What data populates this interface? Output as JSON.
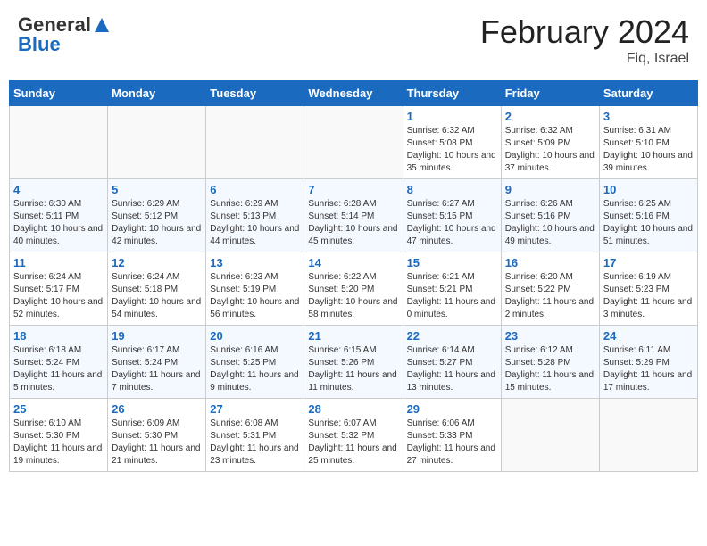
{
  "header": {
    "logo_general": "General",
    "logo_blue": "Blue",
    "month_title": "February 2024",
    "location": "Fiq, Israel"
  },
  "weekdays": [
    "Sunday",
    "Monday",
    "Tuesday",
    "Wednesday",
    "Thursday",
    "Friday",
    "Saturday"
  ],
  "weeks": [
    [
      {
        "day": null,
        "sunrise": null,
        "sunset": null,
        "daylight": null
      },
      {
        "day": null,
        "sunrise": null,
        "sunset": null,
        "daylight": null
      },
      {
        "day": null,
        "sunrise": null,
        "sunset": null,
        "daylight": null
      },
      {
        "day": null,
        "sunrise": null,
        "sunset": null,
        "daylight": null
      },
      {
        "day": "1",
        "sunrise": "Sunrise: 6:32 AM",
        "sunset": "Sunset: 5:08 PM",
        "daylight": "Daylight: 10 hours and 35 minutes."
      },
      {
        "day": "2",
        "sunrise": "Sunrise: 6:32 AM",
        "sunset": "Sunset: 5:09 PM",
        "daylight": "Daylight: 10 hours and 37 minutes."
      },
      {
        "day": "3",
        "sunrise": "Sunrise: 6:31 AM",
        "sunset": "Sunset: 5:10 PM",
        "daylight": "Daylight: 10 hours and 39 minutes."
      }
    ],
    [
      {
        "day": "4",
        "sunrise": "Sunrise: 6:30 AM",
        "sunset": "Sunset: 5:11 PM",
        "daylight": "Daylight: 10 hours and 40 minutes."
      },
      {
        "day": "5",
        "sunrise": "Sunrise: 6:29 AM",
        "sunset": "Sunset: 5:12 PM",
        "daylight": "Daylight: 10 hours and 42 minutes."
      },
      {
        "day": "6",
        "sunrise": "Sunrise: 6:29 AM",
        "sunset": "Sunset: 5:13 PM",
        "daylight": "Daylight: 10 hours and 44 minutes."
      },
      {
        "day": "7",
        "sunrise": "Sunrise: 6:28 AM",
        "sunset": "Sunset: 5:14 PM",
        "daylight": "Daylight: 10 hours and 45 minutes."
      },
      {
        "day": "8",
        "sunrise": "Sunrise: 6:27 AM",
        "sunset": "Sunset: 5:15 PM",
        "daylight": "Daylight: 10 hours and 47 minutes."
      },
      {
        "day": "9",
        "sunrise": "Sunrise: 6:26 AM",
        "sunset": "Sunset: 5:16 PM",
        "daylight": "Daylight: 10 hours and 49 minutes."
      },
      {
        "day": "10",
        "sunrise": "Sunrise: 6:25 AM",
        "sunset": "Sunset: 5:16 PM",
        "daylight": "Daylight: 10 hours and 51 minutes."
      }
    ],
    [
      {
        "day": "11",
        "sunrise": "Sunrise: 6:24 AM",
        "sunset": "Sunset: 5:17 PM",
        "daylight": "Daylight: 10 hours and 52 minutes."
      },
      {
        "day": "12",
        "sunrise": "Sunrise: 6:24 AM",
        "sunset": "Sunset: 5:18 PM",
        "daylight": "Daylight: 10 hours and 54 minutes."
      },
      {
        "day": "13",
        "sunrise": "Sunrise: 6:23 AM",
        "sunset": "Sunset: 5:19 PM",
        "daylight": "Daylight: 10 hours and 56 minutes."
      },
      {
        "day": "14",
        "sunrise": "Sunrise: 6:22 AM",
        "sunset": "Sunset: 5:20 PM",
        "daylight": "Daylight: 10 hours and 58 minutes."
      },
      {
        "day": "15",
        "sunrise": "Sunrise: 6:21 AM",
        "sunset": "Sunset: 5:21 PM",
        "daylight": "Daylight: 11 hours and 0 minutes."
      },
      {
        "day": "16",
        "sunrise": "Sunrise: 6:20 AM",
        "sunset": "Sunset: 5:22 PM",
        "daylight": "Daylight: 11 hours and 2 minutes."
      },
      {
        "day": "17",
        "sunrise": "Sunrise: 6:19 AM",
        "sunset": "Sunset: 5:23 PM",
        "daylight": "Daylight: 11 hours and 3 minutes."
      }
    ],
    [
      {
        "day": "18",
        "sunrise": "Sunrise: 6:18 AM",
        "sunset": "Sunset: 5:24 PM",
        "daylight": "Daylight: 11 hours and 5 minutes."
      },
      {
        "day": "19",
        "sunrise": "Sunrise: 6:17 AM",
        "sunset": "Sunset: 5:24 PM",
        "daylight": "Daylight: 11 hours and 7 minutes."
      },
      {
        "day": "20",
        "sunrise": "Sunrise: 6:16 AM",
        "sunset": "Sunset: 5:25 PM",
        "daylight": "Daylight: 11 hours and 9 minutes."
      },
      {
        "day": "21",
        "sunrise": "Sunrise: 6:15 AM",
        "sunset": "Sunset: 5:26 PM",
        "daylight": "Daylight: 11 hours and 11 minutes."
      },
      {
        "day": "22",
        "sunrise": "Sunrise: 6:14 AM",
        "sunset": "Sunset: 5:27 PM",
        "daylight": "Daylight: 11 hours and 13 minutes."
      },
      {
        "day": "23",
        "sunrise": "Sunrise: 6:12 AM",
        "sunset": "Sunset: 5:28 PM",
        "daylight": "Daylight: 11 hours and 15 minutes."
      },
      {
        "day": "24",
        "sunrise": "Sunrise: 6:11 AM",
        "sunset": "Sunset: 5:29 PM",
        "daylight": "Daylight: 11 hours and 17 minutes."
      }
    ],
    [
      {
        "day": "25",
        "sunrise": "Sunrise: 6:10 AM",
        "sunset": "Sunset: 5:30 PM",
        "daylight": "Daylight: 11 hours and 19 minutes."
      },
      {
        "day": "26",
        "sunrise": "Sunrise: 6:09 AM",
        "sunset": "Sunset: 5:30 PM",
        "daylight": "Daylight: 11 hours and 21 minutes."
      },
      {
        "day": "27",
        "sunrise": "Sunrise: 6:08 AM",
        "sunset": "Sunset: 5:31 PM",
        "daylight": "Daylight: 11 hours and 23 minutes."
      },
      {
        "day": "28",
        "sunrise": "Sunrise: 6:07 AM",
        "sunset": "Sunset: 5:32 PM",
        "daylight": "Daylight: 11 hours and 25 minutes."
      },
      {
        "day": "29",
        "sunrise": "Sunrise: 6:06 AM",
        "sunset": "Sunset: 5:33 PM",
        "daylight": "Daylight: 11 hours and 27 minutes."
      },
      {
        "day": null,
        "sunrise": null,
        "sunset": null,
        "daylight": null
      },
      {
        "day": null,
        "sunrise": null,
        "sunset": null,
        "daylight": null
      }
    ]
  ]
}
